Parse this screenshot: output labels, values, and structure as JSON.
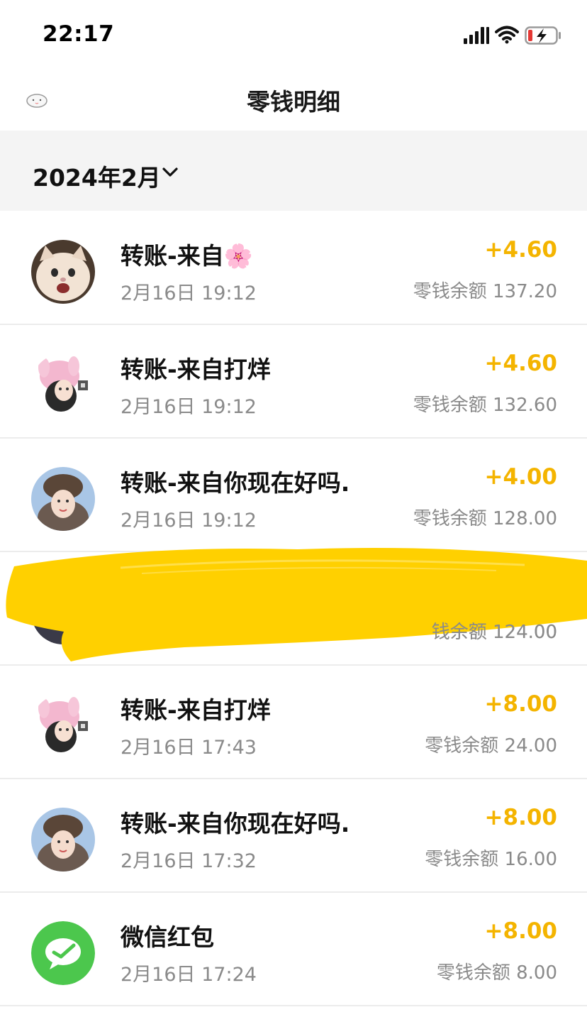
{
  "status_bar": {
    "time": "22:17"
  },
  "nav": {
    "title": "零钱明细"
  },
  "month_filter": {
    "label": "2024年2月"
  },
  "colors": {
    "income": "#f4b400",
    "redaction": "#ffd000",
    "wechat_green": "#4cc74d"
  },
  "transactions": [
    {
      "title": "转账-来自",
      "emoji": "🌸",
      "date": "2月16日 19:12",
      "amount": "+4.60",
      "balance": "零钱余额 137.20",
      "avatar": "cat-avatar"
    },
    {
      "title": "转账-来自打烊",
      "date": "2月16日 19:12",
      "amount": "+4.60",
      "balance": "零钱余额 132.60",
      "avatar": "anime-girl-avatar"
    },
    {
      "title": "转账-来自你现在好吗.",
      "date": "2月16日 19:12",
      "amount": "+4.00",
      "balance": "零钱余额 128.00",
      "avatar": "girl-photo-avatar"
    },
    {
      "title": "",
      "date": "",
      "amount": "",
      "balance": "钱余额 124.00",
      "avatar": "redacted-avatar"
    },
    {
      "title": "转账-来自打烊",
      "date": "2月16日 17:43",
      "amount": "+8.00",
      "balance": "零钱余额 24.00",
      "avatar": "anime-girl-avatar"
    },
    {
      "title": "转账-来自你现在好吗.",
      "date": "2月16日 17:32",
      "amount": "+8.00",
      "balance": "零钱余额 16.00",
      "avatar": "girl-photo-avatar"
    },
    {
      "title": "微信红包",
      "date": "2月16日 17:24",
      "amount": "+8.00",
      "balance": "零钱余额 8.00",
      "avatar": "wechat-red-packet-icon"
    }
  ]
}
